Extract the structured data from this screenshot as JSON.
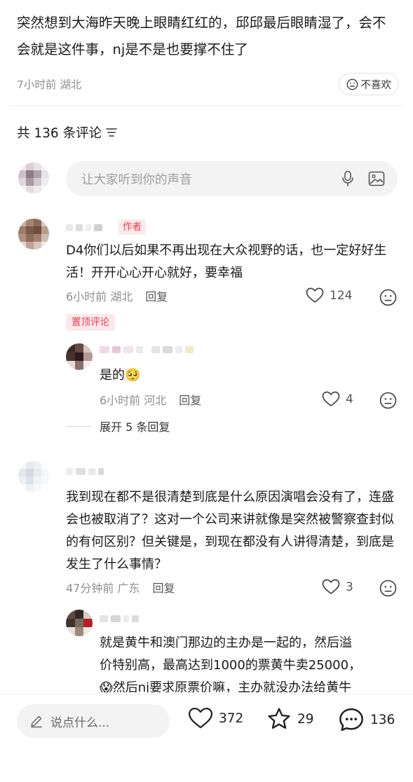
{
  "post": {
    "text": "突然想到大海昨天晚上眼睛红红的，邱邱最后眼睛湿了，会不会就是这件事，nj是不是也要撑不住了",
    "meta": "7小时前 湖北",
    "dislike_label": "不喜欢"
  },
  "comments_header": {
    "label": "共 136 条评论"
  },
  "input": {
    "placeholder": "让大家听到你的声音"
  },
  "comments": [
    {
      "author_tag": "作者",
      "text": "D4你们以后如果不再出现在大众视野的话，也一定好好生活！开开心心开心就好，要幸福",
      "time_location": "6小时前 湖北",
      "reply_label": "回复",
      "likes": "124",
      "pinned_label": "置顶评论",
      "replies": [
        {
          "text": "是的",
          "emoji": "🥺",
          "time_location": "6小时前 河北",
          "reply_label": "回复",
          "likes": "4"
        }
      ],
      "expand_label": "展开 5 条回复"
    },
    {
      "text": "我到现在都不是很清楚到底是什么原因演唱会没有了，连盛会也被取消了？这对一个公司来讲就像是突然被警察查封似的有何区别？但关键是，到现在都没有人讲得清楚，到底是发生了什么事情？",
      "time_location": "47分钟前 广东",
      "reply_label": "回复",
      "likes": "3",
      "replies": [
        {
          "line1": "就是黄牛和澳门那边的主办是一起的，然后溢",
          "line2": "价特别高，最高达到1000的票黄牛卖25000，",
          "line3_emoji": "😱",
          "line3": "然后nj要求原票价嘛，主办就没办法给黄牛"
        }
      ]
    }
  ],
  "bottom_bar": {
    "input_placeholder": "说点什么...",
    "likes": "372",
    "stars": "29",
    "comments": "136"
  },
  "colors": {
    "accent_red": "#ee3a52",
    "tag_bg": "#fde9ec",
    "muted": "#8f8f8f"
  }
}
